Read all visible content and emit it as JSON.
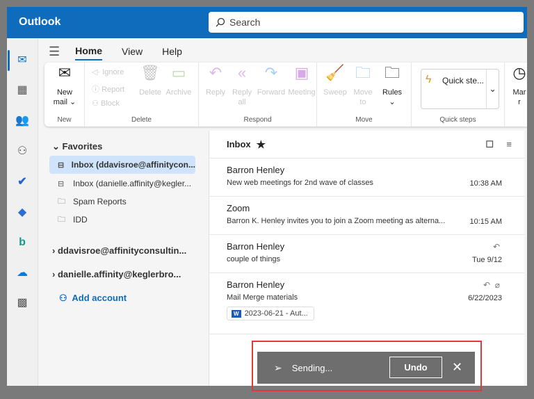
{
  "app": {
    "title": "Outlook",
    "search_placeholder": "Search"
  },
  "tabs": [
    "Home",
    "View",
    "Help"
  ],
  "ribbon": {
    "new": {
      "new_mail": "New",
      "new_mail2": "mail",
      "group": "New"
    },
    "delete": {
      "ignore": "Ignore",
      "report": "Report",
      "block": "Block",
      "delete": "Delete",
      "archive": "Archive",
      "group": "Delete"
    },
    "respond": {
      "reply": "Reply",
      "reply_all": "Reply",
      "reply_all2": "all",
      "forward": "Forward",
      "meeting": "Meeting",
      "group": "Respond"
    },
    "move": {
      "sweep": "Sweep",
      "move_to": "Move",
      "move_to2": "to",
      "rules": "Rules",
      "group": "Move"
    },
    "quick_steps": {
      "label": "Quick ste...",
      "group": "Quick steps"
    },
    "mark": {
      "label": "Mar",
      "label2": "r"
    }
  },
  "folders": {
    "favorites": "Favorites",
    "items": [
      "Inbox (ddavisroe@affinitycon...",
      "Inbox (danielle.affinity@kegler...",
      "Spam Reports",
      "IDD"
    ],
    "accounts": [
      "ddavisroe@affinityconsultin...",
      "danielle.affinity@keglerbro..."
    ],
    "add_account": "Add account"
  },
  "inbox": {
    "title": "Inbox",
    "messages": [
      {
        "from": "Barron Henley",
        "subject": "New web meetings for 2nd wave of classes",
        "time": "10:38 AM"
      },
      {
        "from": "Zoom",
        "subject": "Barron K. Henley invites you to join a Zoom meeting as alterna...",
        "time": "10:15 AM"
      },
      {
        "from": "Barron Henley",
        "subject": "couple of things",
        "time": "Tue 9/12"
      },
      {
        "from": "Barron Henley",
        "subject": "Mail Merge materials",
        "time": "6/22/2023",
        "attachment": "2023-06-21 - Aut..."
      }
    ]
  },
  "snackbar": {
    "status": "Sending...",
    "undo": "Undo"
  },
  "colors": {
    "brand": "#0f6cbd",
    "highlight": "#e0393e"
  }
}
